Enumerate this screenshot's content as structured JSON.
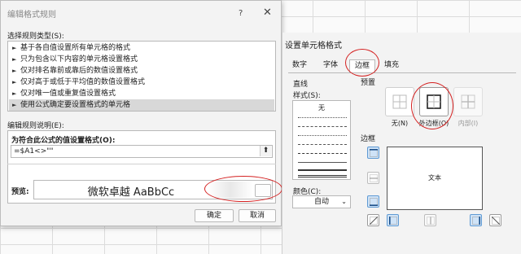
{
  "rule_dialog": {
    "title": "编辑格式规则",
    "help": "?",
    "close": "✕",
    "rule_type_label": "选择规则类型(S):",
    "rule_types": [
      "基于各自值设置所有单元格的格式",
      "只为包含以下内容的单元格设置格式",
      "仅对排名靠前或靠后的数值设置格式",
      "仅对高于或低于平均值的数值设置格式",
      "仅对唯一值或重复值设置格式",
      "使用公式确定要设置格式的单元格"
    ],
    "selected_index": 5,
    "desc_label": "编辑规则说明(E):",
    "formula_label": "为符合此公式的值设置格式(O):",
    "formula_value": "=$A1<>\"\"",
    "preview_label": "预览:",
    "preview_text": "微软卓越  AaBbCc",
    "ok_label": "确定",
    "cancel_label": "取消"
  },
  "format_cells": {
    "title": "设置单元格格式",
    "tabs": [
      "数字",
      "字体",
      "边框",
      "填充"
    ],
    "active_tab": "边框",
    "line_label": "直线",
    "style_label": "样式(S):",
    "style_none": "无",
    "color_label": "颜色(C):",
    "color_value": "自动",
    "presets_label": "预置",
    "presets": [
      "无(N)",
      "外边框(O)",
      "内部(I)"
    ],
    "border_label": "边框",
    "preview_text": "文本"
  },
  "annotation_color": "#d42020"
}
